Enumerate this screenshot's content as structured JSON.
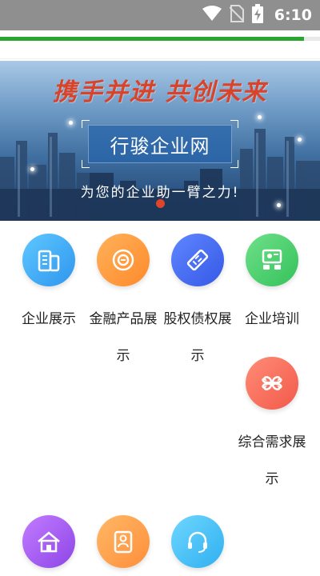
{
  "status_bar": {
    "time": "6:10",
    "icons": [
      "wifi-icon",
      "no-sim-icon",
      "battery-charging-icon"
    ]
  },
  "page_load": {
    "progress_percent": 95
  },
  "banner": {
    "slogan": "携手并进  共创未来",
    "title": "行骏企业网",
    "subtitle": "为您的企业助一臂之力!"
  },
  "features": [
    {
      "id": "enterprise-showcase",
      "label": "企业展示",
      "icon": "building-icon",
      "color_from": "#5ec8ff",
      "color_to": "#2f95ee"
    },
    {
      "id": "financial-products",
      "label": "金融产品展示",
      "icon": "finance-icon",
      "color_from": "#ffb15a",
      "color_to": "#ff8a2b"
    },
    {
      "id": "equity-debt",
      "label": "股权债权展示",
      "icon": "ticket-icon",
      "color_from": "#5f86ff",
      "color_to": "#3559e6"
    },
    {
      "id": "enterprise-training",
      "label": "企业培训",
      "icon": "training-icon",
      "color_from": "#6fe08a",
      "color_to": "#34c25a"
    },
    {
      "id": "demand-showcase",
      "label": "综合需求展示",
      "icon": "clover-icon",
      "color_from": "#ff8c76",
      "color_to": "#f2594a"
    },
    {
      "id": "row3-item1",
      "label": "",
      "icon": "house-icon",
      "color_from": "#c27cff",
      "color_to": "#8d45e6"
    },
    {
      "id": "row3-item2",
      "label": "",
      "icon": "profile-card-icon",
      "color_from": "#ffb866",
      "color_to": "#ff8e3a"
    },
    {
      "id": "row3-item3",
      "label": "",
      "icon": "headset-icon",
      "color_from": "#6fd6ff",
      "color_to": "#2fb0ef"
    }
  ]
}
